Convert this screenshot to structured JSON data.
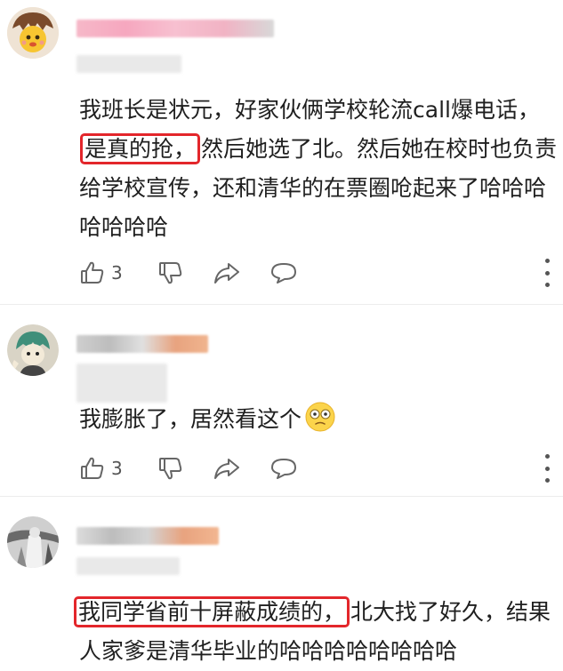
{
  "comments": [
    {
      "text_before": "我班长是状元，好家伙俩学校轮流call爆电话，",
      "highlight": "是真的抢，",
      "text_after": "然后她选了北。然后她在校时也负责给学校宣传，还和清华的在票圈呛起来了哈哈哈哈哈哈哈",
      "like_count": "3"
    },
    {
      "text": "我膨胀了，居然看这个",
      "emoji_icon": "eye-roll-emoji-icon",
      "like_count": "3"
    },
    {
      "highlight": "我同学省前十屏蔽成绩的，",
      "text_after": "北大找了好久，结果人家爹是清华毕业的哈哈哈哈哈哈哈哈"
    }
  ],
  "icons": {
    "like": "thumbs-up-icon",
    "dislike": "thumbs-down-icon",
    "share": "share-icon",
    "reply": "comment-bubble-icon",
    "more": "more-vertical-icon"
  },
  "colors": {
    "highlight_border": "#e3262b",
    "text": "#1f1f1f",
    "icon": "#666666"
  }
}
